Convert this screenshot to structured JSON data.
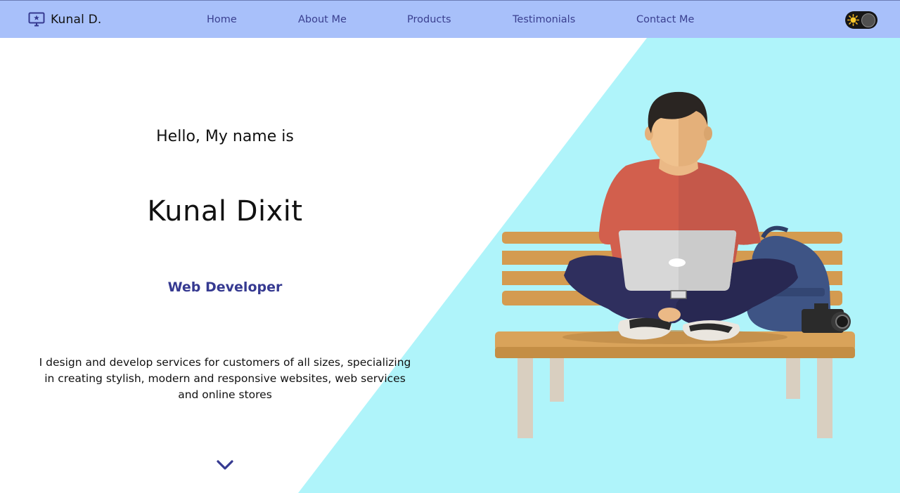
{
  "brand": {
    "name": "Kunal D.",
    "logo_icon": "monitor-star-icon"
  },
  "nav": {
    "links": [
      "Home",
      "About Me",
      "Products",
      "Testimonials",
      "Contact Me"
    ]
  },
  "theme_toggle": {
    "icon": "sun-icon",
    "state": "dark"
  },
  "hero": {
    "greeting": "Hello, My name is",
    "name": "Kunal Dixit",
    "role": "Web Developer",
    "bio": "I design and develop services for customers of all sizes, specializing in creating stylish, modern and responsive websites, web services and online stores",
    "scroll_icon": "chevron-down-icon",
    "illustration": "person-with-laptop-on-bench"
  },
  "colors": {
    "navbar_bg": "#a8c0fa",
    "nav_text": "#3a3f8f",
    "accent": "#363a91",
    "hero_accent_bg": "#aff4fa"
  }
}
